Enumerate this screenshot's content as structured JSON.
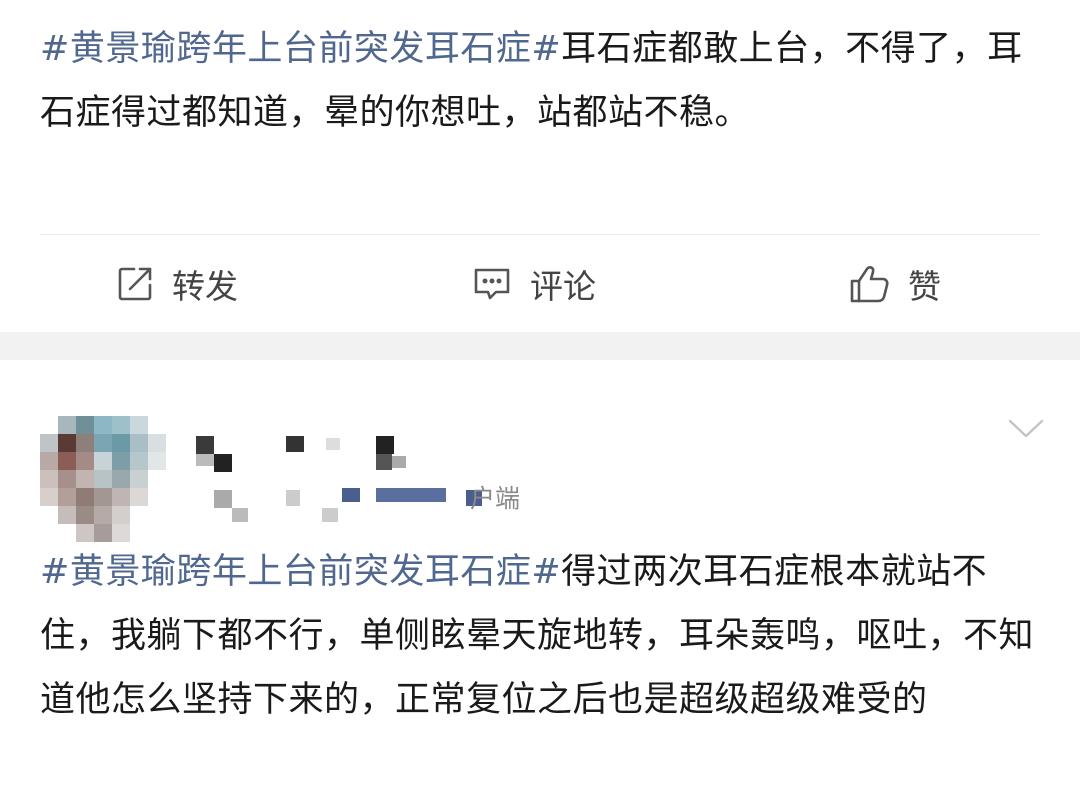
{
  "post1": {
    "hashtag": "#黄景瑜跨年上台前突发耳石症#",
    "text": "耳石症都敢上台，不得了，耳石症得过都知道，晕的你想吐，站都站不稳。"
  },
  "actions": {
    "repost_label": "转发",
    "comment_label": "评论",
    "like_label": "赞"
  },
  "post2": {
    "source_partial": "户端",
    "hashtag": "#黄景瑜跨年上台前突发耳石症#",
    "text": "得过两次耳石症根本就站不住，我躺下都不行，单侧眩晕天旋地转，耳朵轰鸣，呕吐，不知道他怎么坚持下来的，正常复位之后也是超级超级难受的"
  },
  "colors": {
    "hashtag": "#50678f",
    "separator_band": "#f2f2f2",
    "icon_gray": "#555555"
  },
  "icons": [
    "repost-icon",
    "comment-icon",
    "like-icon",
    "chevron-down-icon"
  ]
}
